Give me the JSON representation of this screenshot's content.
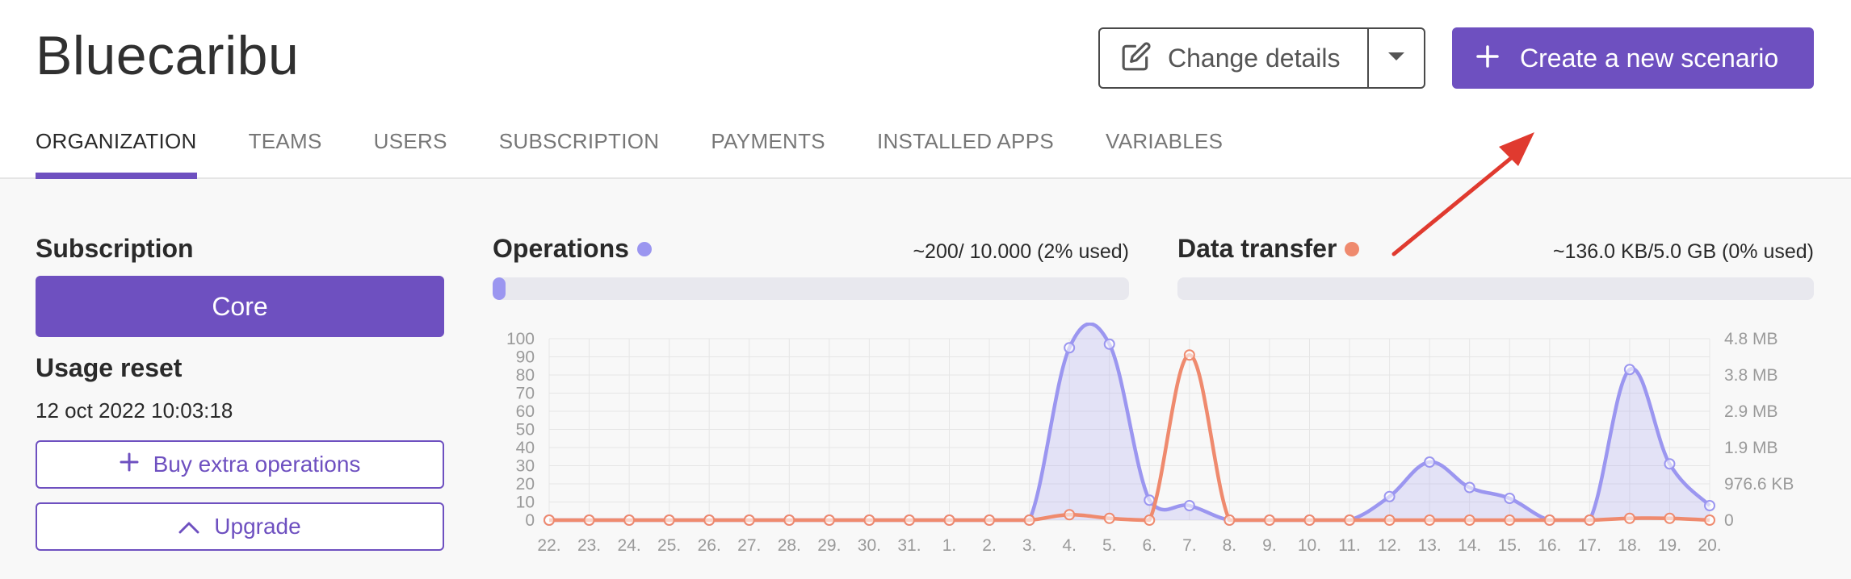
{
  "header": {
    "org_name": "Bluecaribu",
    "change_details_label": "Change details",
    "create_scenario_label": "Create a new scenario"
  },
  "tabs": [
    {
      "label": "ORGANIZATION",
      "active": true
    },
    {
      "label": "TEAMS"
    },
    {
      "label": "USERS"
    },
    {
      "label": "SUBSCRIPTION"
    },
    {
      "label": "PAYMENTS"
    },
    {
      "label": "INSTALLED APPS"
    },
    {
      "label": "VARIABLES"
    }
  ],
  "subscription": {
    "title": "Subscription",
    "plan": "Core",
    "usage_reset_title": "Usage reset",
    "usage_reset_date": "12 oct 2022 10:03:18",
    "buy_label": "Buy extra operations",
    "upgrade_label": "Upgrade"
  },
  "operations": {
    "title": "Operations",
    "usage": "~200/ 10.000 (2% used)",
    "fraction_used": 0.02,
    "color": "#9b96f0"
  },
  "data_transfer": {
    "title": "Data transfer",
    "usage": "~136.0 KB/5.0 GB (0% used)",
    "fraction_used": 0.0,
    "color": "#ef8a6e"
  },
  "colors": {
    "accent": "#6e50c0",
    "annotation_arrow": "#e03a2f"
  },
  "icons": {
    "change_details": "edit-icon",
    "dropdown": "caret-down-icon",
    "create": "plus-icon",
    "buy": "plus-icon",
    "upgrade": "chevron-up-icon"
  },
  "chart_data": {
    "type": "line",
    "x": [
      "22.",
      "23.",
      "24.",
      "25.",
      "26.",
      "27.",
      "28.",
      "29.",
      "30.",
      "31.",
      "1.",
      "2.",
      "3.",
      "4.",
      "5.",
      "6.",
      "7.",
      "8.",
      "9.",
      "10.",
      "11.",
      "12.",
      "13.",
      "14.",
      "15.",
      "16.",
      "17.",
      "18.",
      "19.",
      "20."
    ],
    "y_left_ticks": [
      "0",
      "10",
      "20",
      "30",
      "40",
      "50",
      "60",
      "70",
      "80",
      "90",
      "100"
    ],
    "y_right_ticks": [
      "0",
      "976.6 KB",
      "1.9 MB",
      "2.9 MB",
      "3.8 MB",
      "4.8 MB"
    ],
    "ylim_left": [
      0,
      100
    ],
    "grid": true,
    "series": [
      {
        "axis": "left",
        "color": "#9b96f0",
        "fill": true,
        "values": [
          0,
          0,
          0,
          0,
          0,
          0,
          0,
          0,
          0,
          0,
          0,
          0,
          0,
          95,
          97,
          11,
          8,
          0,
          0,
          0,
          0,
          13,
          32,
          18,
          12,
          0,
          0,
          83,
          31,
          8
        ]
      },
      {
        "axis": "right",
        "color": "#ef8a6e",
        "fill": false,
        "values": [
          0,
          0,
          0,
          0,
          0,
          0,
          0,
          0,
          0,
          0,
          0,
          0,
          0,
          3,
          1,
          0,
          91,
          0,
          0,
          0,
          0,
          0,
          0,
          0,
          0,
          0,
          0,
          1,
          1,
          0
        ]
      }
    ]
  }
}
